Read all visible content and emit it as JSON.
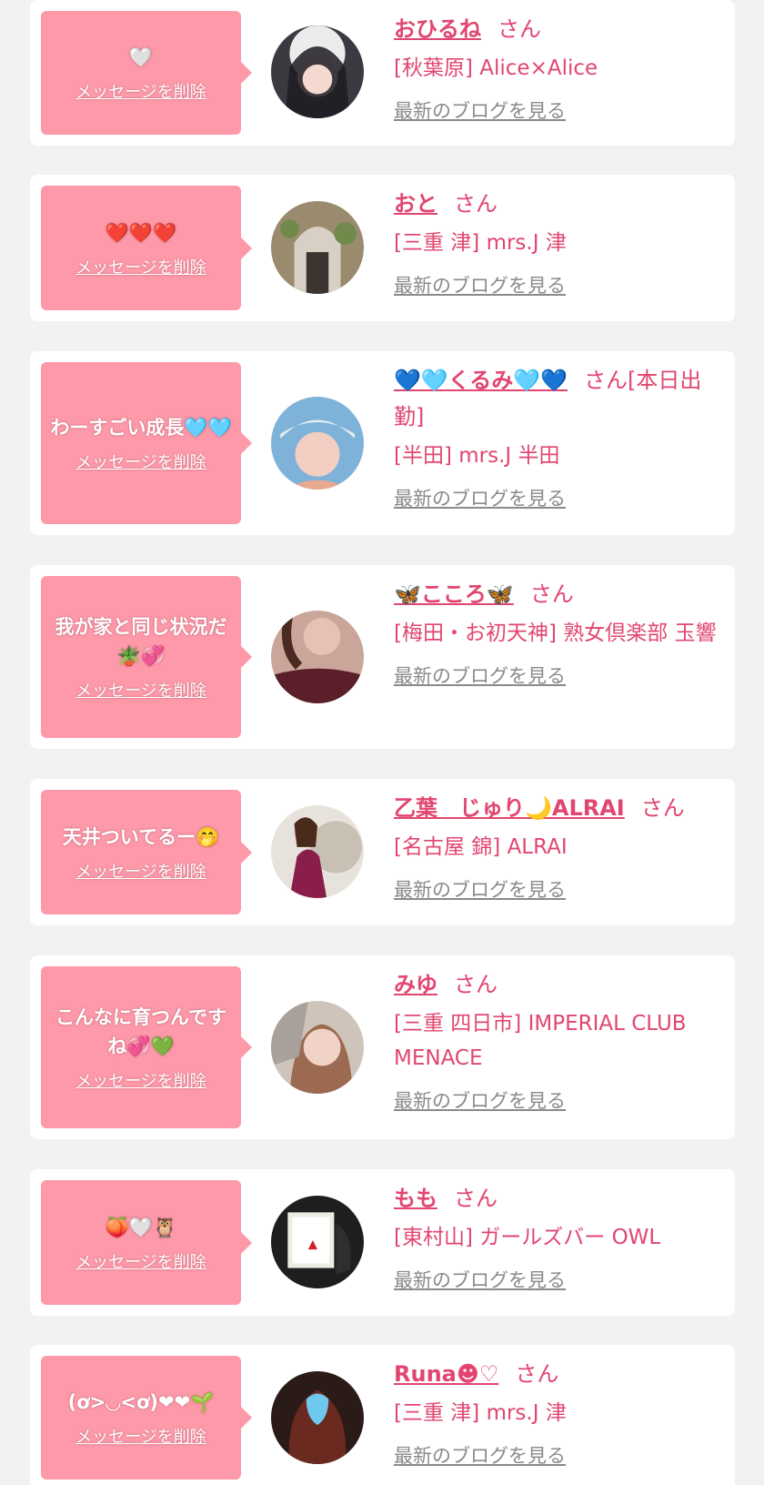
{
  "common": {
    "delete_label": "メッセージを削除",
    "blog_label": "最新のブログを見る",
    "san_label": "さん"
  },
  "colors": {
    "bubble": "#fd99a8",
    "name": "#e14670",
    "link_gray": "#8a8a8a",
    "background": "#f2f2f2"
  },
  "messages": [
    {
      "message": "🤍",
      "name": "おひるね",
      "san": "さん",
      "shop": "[秋葉原] Alice×Alice"
    },
    {
      "message": "❤️❤️❤️",
      "name": "おと",
      "san": "さん",
      "shop": "[三重 津] mrs.J 津"
    },
    {
      "message": "わーすごい成長🩵🩵",
      "name": "💙🩵くるみ🩵💙",
      "san": "さん[本日出勤]",
      "shop": "[半田] mrs.J 半田"
    },
    {
      "message": "我が家と同じ状況だ🪴💞",
      "name": "🦋こころ🦋",
      "san": "さん",
      "shop": "[梅田・お初天神] 熟女倶楽部 玉響"
    },
    {
      "message": "天井ついてるー🤭",
      "name": "乙葉　じゅり🌙ALRAI",
      "san": "さん",
      "shop": "[名古屋 錦] ALRAI"
    },
    {
      "message": "こんなに育つんですね💞💚",
      "name": "みゆ",
      "san": "さん",
      "shop": "[三重 四日市] IMPERIAL CLUB MENACE"
    },
    {
      "message": "🍑🤍🦉",
      "name": "もも",
      "san": "さん",
      "shop": "[東村山] ガールズバー OWL"
    },
    {
      "message": "(ơ>◡<ơ)❤❤🌱",
      "name": "Runa☻♡",
      "san": "さん",
      "shop": "[三重 津] mrs.J 津"
    }
  ]
}
